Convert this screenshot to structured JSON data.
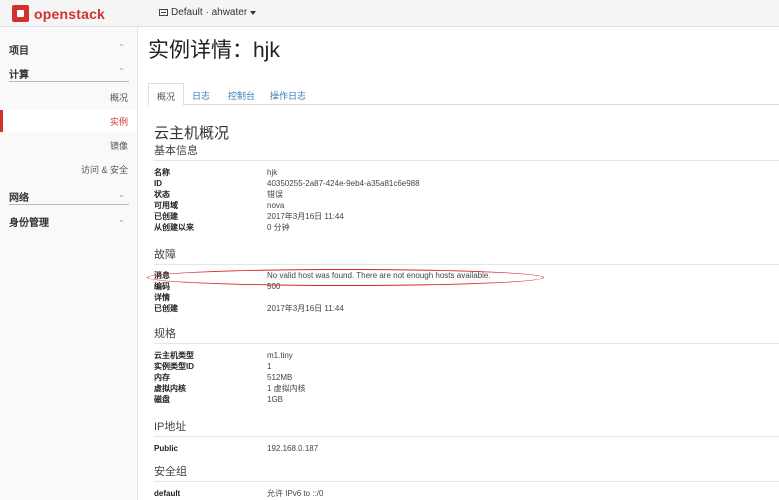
{
  "navbar": {
    "brand": "openstack",
    "project_picker": "Default · ahwater"
  },
  "sidebar": {
    "sections": [
      {
        "label": "项目",
        "chevron": "^"
      },
      {
        "label": "计算",
        "chevron": "^"
      },
      {
        "label": "网络",
        "chevron": "v"
      },
      {
        "label": "身份管理",
        "chevron": "v"
      }
    ],
    "items": [
      {
        "label": "概况",
        "active": false
      },
      {
        "label": "实例",
        "active": true
      },
      {
        "label": "镜像",
        "active": false
      },
      {
        "label": "访问 & 安全",
        "active": false
      }
    ]
  },
  "page": {
    "title": "实例详情：hjk",
    "tabs": [
      "概况",
      "日志",
      "控制台",
      "操作日志"
    ],
    "overview_heading": "云主机概况"
  },
  "basic_info": {
    "heading": "基本信息",
    "rows": [
      {
        "k": "名称",
        "v": "hjk"
      },
      {
        "k": "ID",
        "v": "40350255-2a87-424e-9eb4-a35a81c6e988"
      },
      {
        "k": "状态",
        "v": "错误"
      },
      {
        "k": "可用域",
        "v": "nova"
      },
      {
        "k": "已创建",
        "v": "2017年3月16日 11:44"
      },
      {
        "k": "从创建以来",
        "v": "0 分钟"
      }
    ]
  },
  "fault": {
    "heading": "故障",
    "rows": [
      {
        "k": "消息",
        "v": "No valid host was found. There are not enough hosts available."
      },
      {
        "k": "编码",
        "v": "500"
      },
      {
        "k": "详情",
        "v": ""
      },
      {
        "k": "已创建",
        "v": "2017年3月16日 11:44"
      }
    ]
  },
  "specs": {
    "heading": "规格",
    "rows": [
      {
        "k": "云主机类型",
        "v": "m1.tiny"
      },
      {
        "k": "实例类型ID",
        "v": "1"
      },
      {
        "k": "内存",
        "v": "512MB"
      },
      {
        "k": "虚拟内核",
        "v": "1 虚拟内核"
      },
      {
        "k": "磁盘",
        "v": "1GB"
      }
    ]
  },
  "ip": {
    "heading": "IP地址",
    "rows": [
      {
        "k": "Public",
        "v": "192.168.0.187"
      }
    ]
  },
  "security": {
    "heading": "安全组",
    "rows": [
      {
        "k": "default",
        "v": "允许 IPv6 to ::/0"
      }
    ]
  },
  "colors": {
    "brand": "#d2312c",
    "link": "#337ab7",
    "annotation": "#d9262b"
  }
}
